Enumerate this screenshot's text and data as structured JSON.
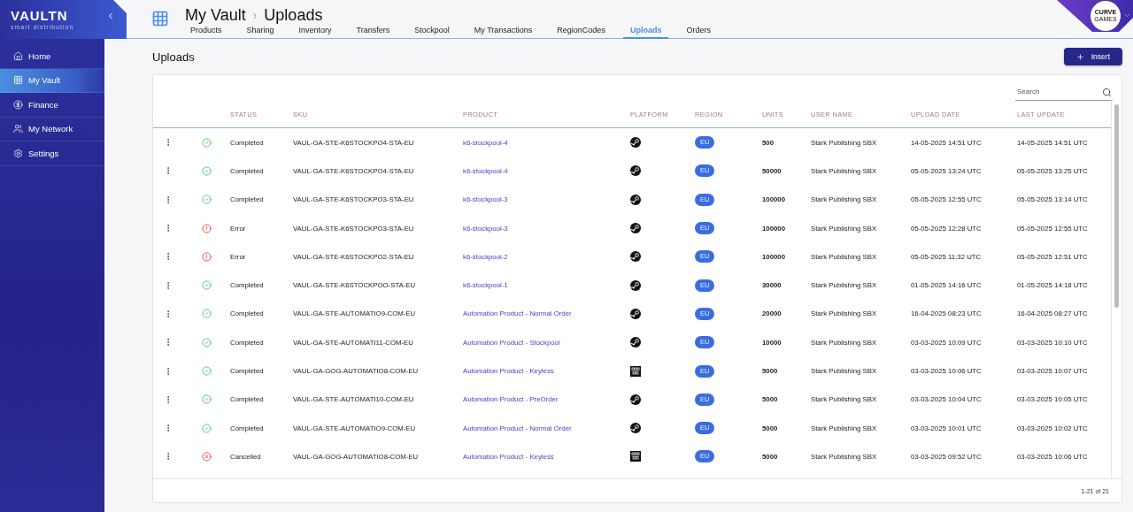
{
  "logo": {
    "name": "VAULTN",
    "tagline": "smart distribution"
  },
  "sidebar": {
    "items": [
      {
        "label": "Home",
        "selected": false
      },
      {
        "label": "My Vault",
        "selected": true
      },
      {
        "label": "Finance",
        "selected": false
      },
      {
        "label": "My Network",
        "selected": false
      },
      {
        "label": "Settings",
        "selected": false
      }
    ]
  },
  "header": {
    "breadcrumb": [
      "My Vault",
      "Uploads"
    ],
    "separator": "›",
    "tabs": [
      {
        "label": "Products",
        "selected": false
      },
      {
        "label": "Sharing",
        "selected": false
      },
      {
        "label": "Inventory",
        "selected": false
      },
      {
        "label": "Transfers",
        "selected": false
      },
      {
        "label": "Stockpool",
        "selected": false
      },
      {
        "label": "My Transactions",
        "selected": false
      },
      {
        "label": "RegionCodes",
        "selected": false
      },
      {
        "label": "Uploads",
        "selected": true
      },
      {
        "label": "Orders",
        "selected": false
      }
    ],
    "account": {
      "line1": "CURVE",
      "line2": "GAMES"
    }
  },
  "page": {
    "title": "Uploads",
    "insert_button": "Insert"
  },
  "table": {
    "search": {
      "placeholder": "Search"
    },
    "columns": [
      "STATUS",
      "SKU",
      "PRODUCT",
      "PLATFORM",
      "REGION",
      "UNITS",
      "USER NAME",
      "UPLOAD DATE",
      "LAST UPDATE"
    ],
    "rows": [
      {
        "status": {
          "kind": "completed",
          "label": "Completed"
        },
        "sku": "VAUL-GA-STE-K6STOCKPO4-STA-EU",
        "product": "k6-stockpool-4",
        "platform": {
          "kind": "steam"
        },
        "region": "EU",
        "units": "500",
        "user": "Stark Publishing SBX",
        "upload_date": "14-05-2025 14:51 UTC",
        "last_update": "14-05-2025 14:51 UTC"
      },
      {
        "status": {
          "kind": "completed",
          "label": "Completed"
        },
        "sku": "VAUL-GA-STE-K6STOCKPO4-STA-EU",
        "product": "k6-stockpool-4",
        "platform": {
          "kind": "steam"
        },
        "region": "EU",
        "units": "50000",
        "user": "Stark Publishing SBX",
        "upload_date": "05-05-2025 13:24 UTC",
        "last_update": "05-05-2025 13:25 UTC"
      },
      {
        "status": {
          "kind": "completed",
          "label": "Completed"
        },
        "sku": "VAUL-GA-STE-K6STOCKPO3-STA-EU",
        "product": "k6-stockpool-3",
        "platform": {
          "kind": "steam"
        },
        "region": "EU",
        "units": "100000",
        "user": "Stark Publishing SBX",
        "upload_date": "05-05-2025 12:55 UTC",
        "last_update": "05-05-2025 13:14 UTC"
      },
      {
        "status": {
          "kind": "error",
          "label": "Error"
        },
        "sku": "VAUL-GA-STE-K6STOCKPO3-STA-EU",
        "product": "k6-stockpool-3",
        "platform": {
          "kind": "steam"
        },
        "region": "EU",
        "units": "100000",
        "user": "Stark Publishing SBX",
        "upload_date": "05-05-2025 12:28 UTC",
        "last_update": "05-05-2025 12:55 UTC"
      },
      {
        "status": {
          "kind": "error",
          "label": "Error"
        },
        "sku": "VAUL-GA-STE-K6STOCKPO2-STA-EU",
        "product": "k6-stockpool-2",
        "platform": {
          "kind": "steam"
        },
        "region": "EU",
        "units": "100000",
        "user": "Stark Publishing SBX",
        "upload_date": "05-05-2025 11:32 UTC",
        "last_update": "05-05-2025 12:51 UTC"
      },
      {
        "status": {
          "kind": "completed",
          "label": "Completed"
        },
        "sku": "VAUL-GA-STE-K6STOCKPOO-STA-EU",
        "product": "k6-stockpool-1",
        "platform": {
          "kind": "steam"
        },
        "region": "EU",
        "units": "30000",
        "user": "Stark Publishing SBX",
        "upload_date": "01-05-2025 14:16 UTC",
        "last_update": "01-05-2025 14:18 UTC"
      },
      {
        "status": {
          "kind": "completed",
          "label": "Completed"
        },
        "sku": "VAUL-GA-STE-AUTOMATIO9-COM-EU",
        "product": "Automation Product - Normal Order",
        "platform": {
          "kind": "steam"
        },
        "region": "EU",
        "units": "20000",
        "user": "Stark Publishing SBX",
        "upload_date": "16-04-2025 08:23 UTC",
        "last_update": "16-04-2025 08:27 UTC"
      },
      {
        "status": {
          "kind": "completed",
          "label": "Completed"
        },
        "sku": "VAUL-GA-STE-AUTOMATI11-COM-EU",
        "product": "Automation Product - Stockpool",
        "platform": {
          "kind": "steam"
        },
        "region": "EU",
        "units": "10000",
        "user": "Stark Publishing SBX",
        "upload_date": "03-03-2025 10:09 UTC",
        "last_update": "03-03-2025 10:10 UTC"
      },
      {
        "status": {
          "kind": "completed",
          "label": "Completed"
        },
        "sku": "VAUL-GA-GOG-AUTOMATIO8-COM-EU",
        "product": "Automation Product - Keyless",
        "platform": {
          "kind": "gog"
        },
        "region": "EU",
        "units": "5000",
        "user": "Stark Publishing SBX",
        "upload_date": "03-03-2025 10:06 UTC",
        "last_update": "03-03-2025 10:07 UTC"
      },
      {
        "status": {
          "kind": "completed",
          "label": "Completed"
        },
        "sku": "VAUL-GA-STE-AUTOMATI10-COM-EU",
        "product": "Automation Product - PreOrder",
        "platform": {
          "kind": "steam"
        },
        "region": "EU",
        "units": "5000",
        "user": "Stark Publishing SBX",
        "upload_date": "03-03-2025 10:04 UTC",
        "last_update": "03-03-2025 10:05 UTC"
      },
      {
        "status": {
          "kind": "completed",
          "label": "Completed"
        },
        "sku": "VAUL-GA-STE-AUTOMATIO9-COM-EU",
        "product": "Automation Product - Normal Order",
        "platform": {
          "kind": "steam"
        },
        "region": "EU",
        "units": "5000",
        "user": "Stark Publishing SBX",
        "upload_date": "03-03-2025 10:01 UTC",
        "last_update": "03-03-2025 10:02 UTC"
      },
      {
        "status": {
          "kind": "cancelled",
          "label": "Cancelled"
        },
        "sku": "VAUL-GA-GOG-AUTOMATIO8-COM-EU",
        "product": "Automation Product - Keyless",
        "platform": {
          "kind": "gog"
        },
        "region": "EU",
        "units": "5000",
        "user": "Stark Publishing SBX",
        "upload_date": "03-03-2025 09:52 UTC",
        "last_update": "03-03-2025 10:06 UTC"
      }
    ],
    "pagination": "1-21 of 21"
  }
}
